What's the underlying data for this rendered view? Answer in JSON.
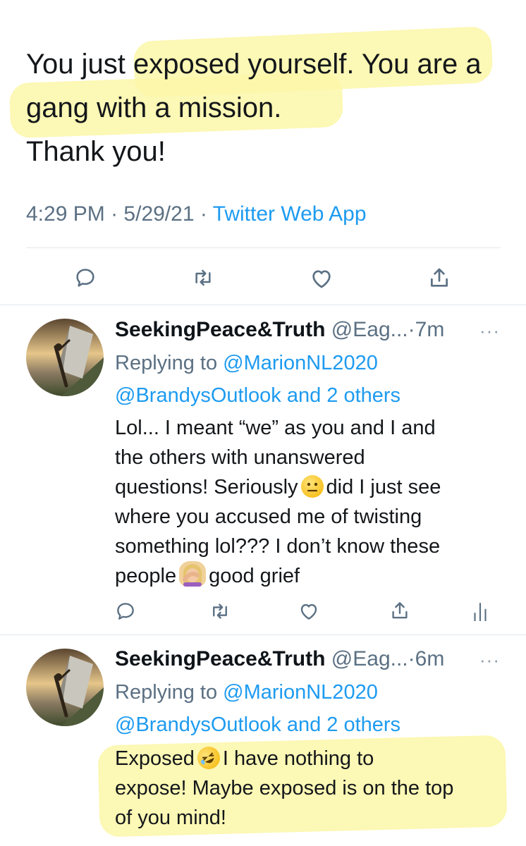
{
  "tweet": {
    "text_lines": [
      "You just exposed yourself. You are a",
      "gang with a mission.",
      "Thank you!"
    ],
    "time": "4:29 PM",
    "sep1": "·",
    "date": "5/29/21",
    "sep2": "·",
    "client": "Twitter Web App",
    "highlight_color": "#fbf7a8"
  },
  "replies": [
    {
      "display_name": "SeekingPeace&Truth",
      "handle": "@Eag...",
      "sep": "·",
      "time": "7m",
      "more": "···",
      "replying_to_label": "Replying to",
      "replying_to_user": "@MarionNL2020",
      "replying_to_line2": "@BrandysOutlook and 2 others",
      "lines": [
        "Lol... I meant “we” as you and I and",
        "the others with unanswered"
      ],
      "line3_before": "questions! Seriously",
      "line3_emoji": "neutral-face-emoji",
      "line3_after": "did I just see",
      "lines_tail": [
        "where you accused me of twisting",
        "something lol??? I don’t know these"
      ],
      "line6_before": "people",
      "line6_emoji": "facepalm-emoji",
      "line6_after": "good grief"
    },
    {
      "display_name": "SeekingPeace&Truth",
      "handle": "@Eag...",
      "sep": "·",
      "time": "6m",
      "more": "···",
      "replying_to_label": "Replying to",
      "replying_to_user": "@MarionNL2020",
      "replying_to_line2": "@BrandysOutlook and 2 others",
      "line1_before": "Exposed",
      "line1_emoji": "rofl-emoji",
      "line1_after": "I have nothing to",
      "lines": [
        "expose! Maybe exposed is on the top",
        "of you mind!"
      ]
    }
  ],
  "icons": {
    "reply": "reply-icon",
    "retweet": "retweet-icon",
    "like": "like-icon",
    "share": "share-icon",
    "analytics": "analytics-icon"
  },
  "colors": {
    "link": "#1d9bf0",
    "secondary": "#5b7083",
    "icon": "#5b7083"
  }
}
